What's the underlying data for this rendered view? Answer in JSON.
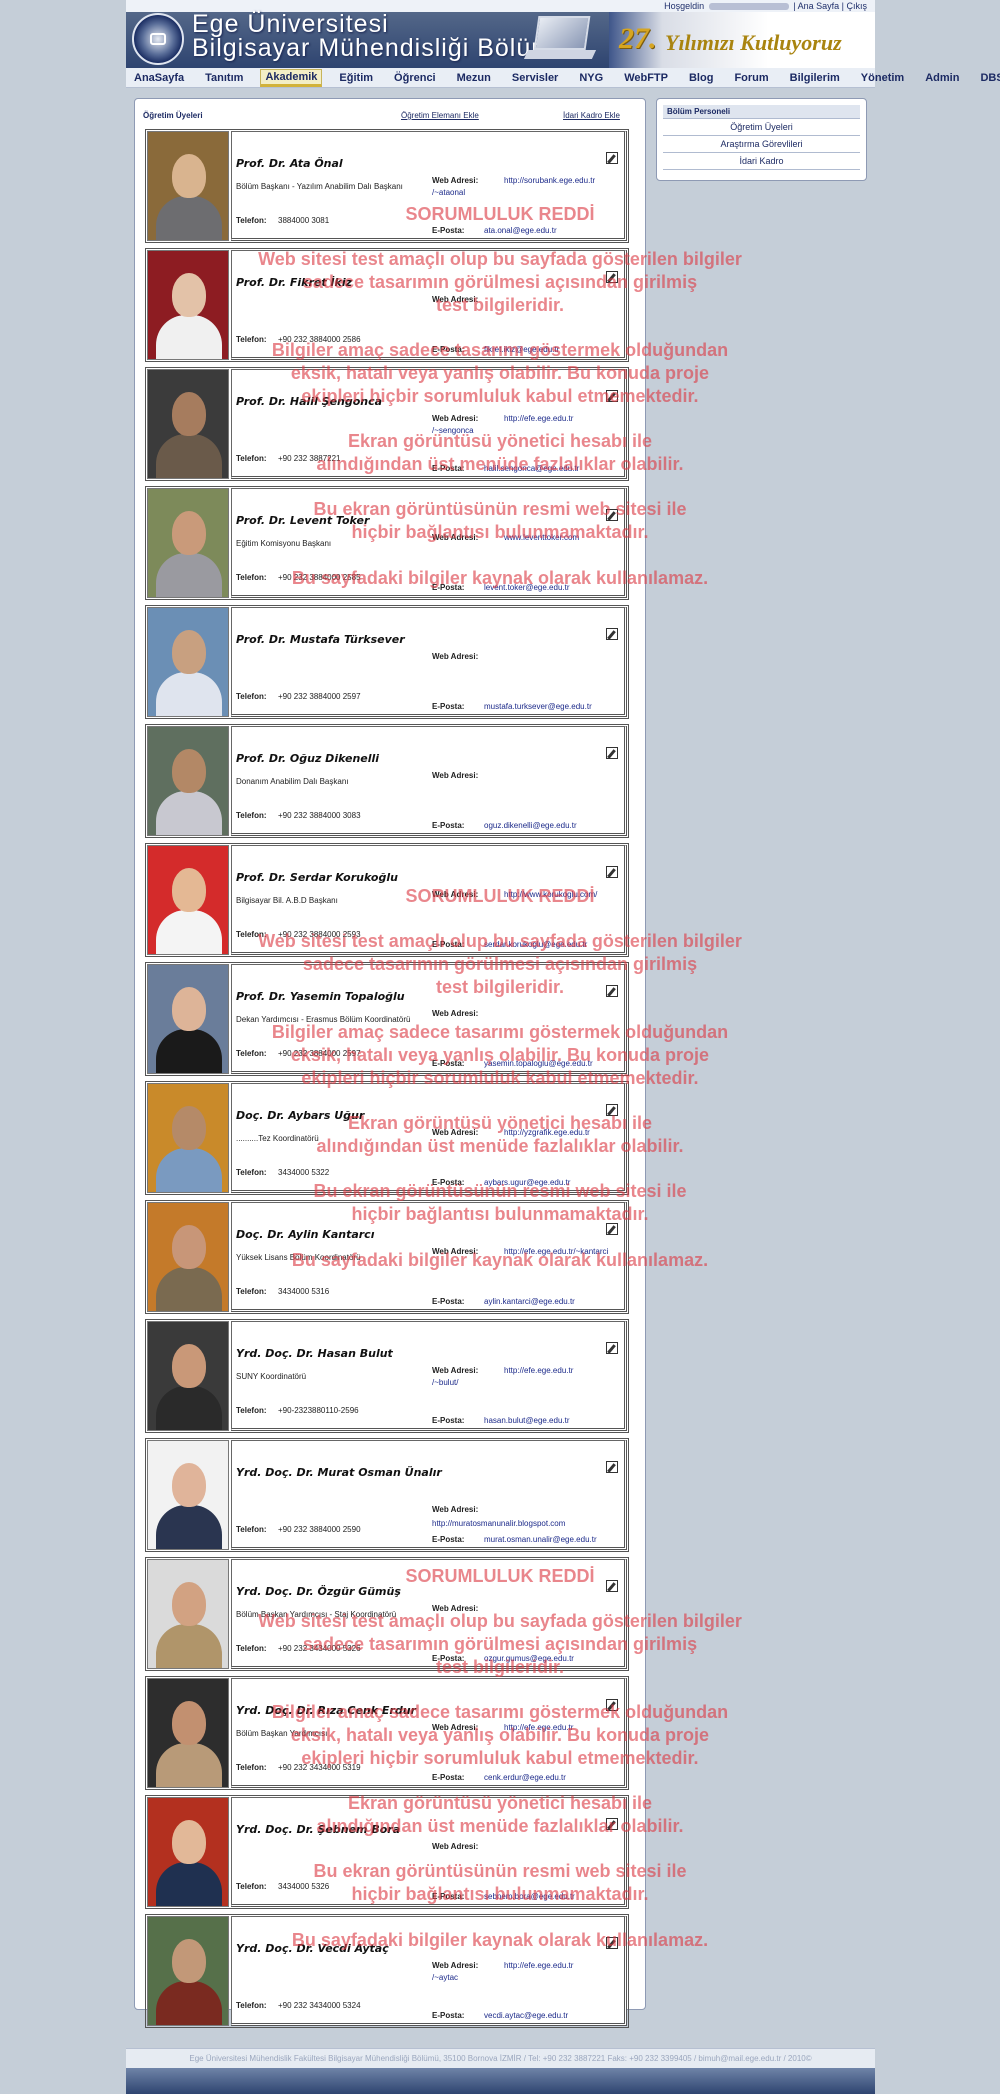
{
  "header": {
    "userbar_greeting": "Hoşgeldin",
    "userbar_home": "Ana Sayfa",
    "userbar_sep": "|",
    "userbar_logout": "Çıkış",
    "title_line1": "Ege Üniversitesi",
    "title_line2": "Bilgisayar Mühendisliği Bölümü",
    "anniv_number": "27.",
    "anniv_text": "Yılımızı Kutluyoruz"
  },
  "nav": [
    "AnaSayfa",
    "Tanıtım",
    "Akademik",
    "Eğitim",
    "Öğrenci",
    "Mezun",
    "Servisler",
    "NYG",
    "WebFTP",
    "Blog",
    "Forum",
    "Bilgilerim",
    "Yönetim",
    "Admin",
    "DBS"
  ],
  "nav_active": "Akademik",
  "panel": {
    "title": "Öğretim Üyeleri",
    "add_staff": "Öğretim Elemanı Ekle",
    "add_admin": "İdari Kadro Ekle"
  },
  "labels": {
    "phone": "Telefon:",
    "web": "Web Adresi:",
    "email": "E-Posta:"
  },
  "people": [
    {
      "name": "Prof. Dr. Ata Önal",
      "role": "Bölüm Başkanı - Yazılım Anabilim Dalı Başkanı",
      "phone": "3884000 3081",
      "web": "http://sorubank.ege.edu.tr",
      "web2": "/~ataonal",
      "email": "ata.onal@ege.edu.tr"
    },
    {
      "name": "Prof. Dr. Fikret İkiz",
      "role": "",
      "phone": "+90 232 3884000 2586",
      "web": "",
      "web2": "",
      "email": "fikret.ikiz@ege.edu.tr"
    },
    {
      "name": "Prof. Dr. Halil Şengonca",
      "role": "",
      "phone": "+90 232 3887221",
      "web": "http://efe.ege.edu.tr",
      "web2": "/~sengonca",
      "email": "halil.sengonca@ege.edu.tr"
    },
    {
      "name": "Prof. Dr. Levent Toker",
      "role": "Eğitim Komisyonu Başkanı",
      "phone": "+90 232 3884000 2585",
      "web": "www.leventtoker.com",
      "web2": "",
      "email": "levent.toker@ege.edu.tr"
    },
    {
      "name": "Prof. Dr. Mustafa Türksever",
      "role": "",
      "phone": "+90 232 3884000 2597",
      "web": "",
      "web2": "",
      "email": "mustafa.turksever@ege.edu.tr"
    },
    {
      "name": "Prof. Dr. Oğuz Dikenelli",
      "role": "Donanım Anabilim Dalı Başkanı",
      "phone": "+90 232 3884000 3083",
      "web": "",
      "web2": "",
      "email": "oguz.dikenelli@ege.edu.tr"
    },
    {
      "name": "Prof. Dr. Serdar Korukoğlu",
      "role": "Bilgisayar Bil. A.B.D Başkanı",
      "phone": "+90 232 3884000 2593",
      "web": "http://www.korukoglu.com/",
      "web2": "",
      "email": "serdar.korukoglu@ege.edu.tr"
    },
    {
      "name": "Prof. Dr. Yasemin Topaloğlu",
      "role": "Dekan Yardımcısı - Erasmus Bölüm Koordinatörü",
      "phone": "+90 232 3884000 2597",
      "web": "",
      "web2": "",
      "email": "yasemin.topaloglu@ege.edu.tr"
    },
    {
      "name": "Doç. Dr. Aybars Uğur",
      "role": "..........Tez Koordinatörü",
      "phone": "3434000 5322",
      "web": "http://yzgrafik.ege.edu.tr",
      "web2": "",
      "email": "aybars.ugur@ege.edu.tr"
    },
    {
      "name": "Doç. Dr. Aylin Kantarcı",
      "role": "Yüksek Lisans Bölüm Koordinatörü",
      "phone": "3434000 5316",
      "web": "http://efe.ege.edu.tr/~kantarci",
      "web2": "",
      "email": "aylin.kantarci@ege.edu.tr"
    },
    {
      "name": "Yrd. Doç. Dr. Hasan Bulut",
      "role": "SUNY Koordinatörü",
      "phone": "+90-2323880110-2596",
      "web": "http://efe.ege.edu.tr",
      "web2": "/~bulut/",
      "email": "hasan.bulut@ege.edu.tr"
    },
    {
      "name": "Yrd. Doç. Dr. Murat Osman Ünalır",
      "role": "",
      "phone": "+90 232 3884000 2590",
      "web": "http://muratosmanunalir.blogspot.com",
      "web2": "",
      "email": "murat.osman.unalir@ege.edu.tr",
      "web_below": true
    },
    {
      "name": "Yrd. Doç. Dr. Özgür Gümüş",
      "role": "Bölüm Başkan Yardımcısı - Staj Koordinatörü",
      "phone": "+90 232 3434000 5326",
      "web": "",
      "web2": "",
      "email": "ozgur.gumus@ege.edu.tr"
    },
    {
      "name": "Yrd. Doç. Dr. Rıza Cenk Erdur",
      "role": "Bölüm Başkan Yardımcısı",
      "phone": "+90 232 3434000 5319",
      "web": "http://efe.ege.edu.tr",
      "web2": "",
      "email": "cenk.erdur@ege.edu.tr"
    },
    {
      "name": "Yrd. Doç. Dr. Şebnem Bora",
      "role": "",
      "phone": "3434000 5326",
      "web": "",
      "web2": "",
      "email": "sebnem.bora@ege.edu.tr"
    },
    {
      "name": "Yrd. Doç. Dr. Vecdi Aytaç",
      "role": "",
      "phone": "+90 232 3434000 5324",
      "web": "http://efe.ege.edu.tr",
      "web2": "/~aytac",
      "email": "vecdi.aytac@ege.edu.tr"
    }
  ],
  "sidebar": {
    "title": "Bölüm Personeli",
    "items": [
      "Öğretim Üyeleri",
      "Araştırma Görevlileri",
      "İdari Kadro"
    ]
  },
  "footer": "Ege Üniversitesi Mühendislik Fakültesi Bilgisayar Mühendisliği Bölümü, 35100 Bornova İZMİR / Tel: +90 232 3887221 Faks: +90 232 3399405 / bimuh@mail.ege.edu.tr / 2010©",
  "watermark": {
    "title": "SORUMLULUK REDDİ",
    "line1": "Web sitesi test amaçlı olup bu sayfada gösterilen bilgiler",
    "line2": "sadece tasarımın görülmesi açısından girilmiş",
    "line3": "test bilgileridir.",
    "line4": "Bilgiler amaç sadece tasarımı göstermek olduğundan",
    "line5": "eksik, hatalı veya yanlış olabilir. Bu konuda proje",
    "line6": "ekipleri hiçbir sorumluluk kabul etmemektedir.",
    "line7": "Ekran görüntüsü yönetici hesabı ile",
    "line8": "alındığından üst menüde fazlalıklar olabilir.",
    "line9": "Bu ekran görüntüsünün resmi web sitesi ile",
    "line10": "hiçbir bağlantısı bulunmamaktadır.",
    "line11": "Bu sayfadaki bilgiler kaynak olarak kullanılamaz."
  },
  "colors": {
    "accent": "#1c2a63",
    "page_bg": "#c5ced8",
    "watermark": "#dc3c46"
  }
}
